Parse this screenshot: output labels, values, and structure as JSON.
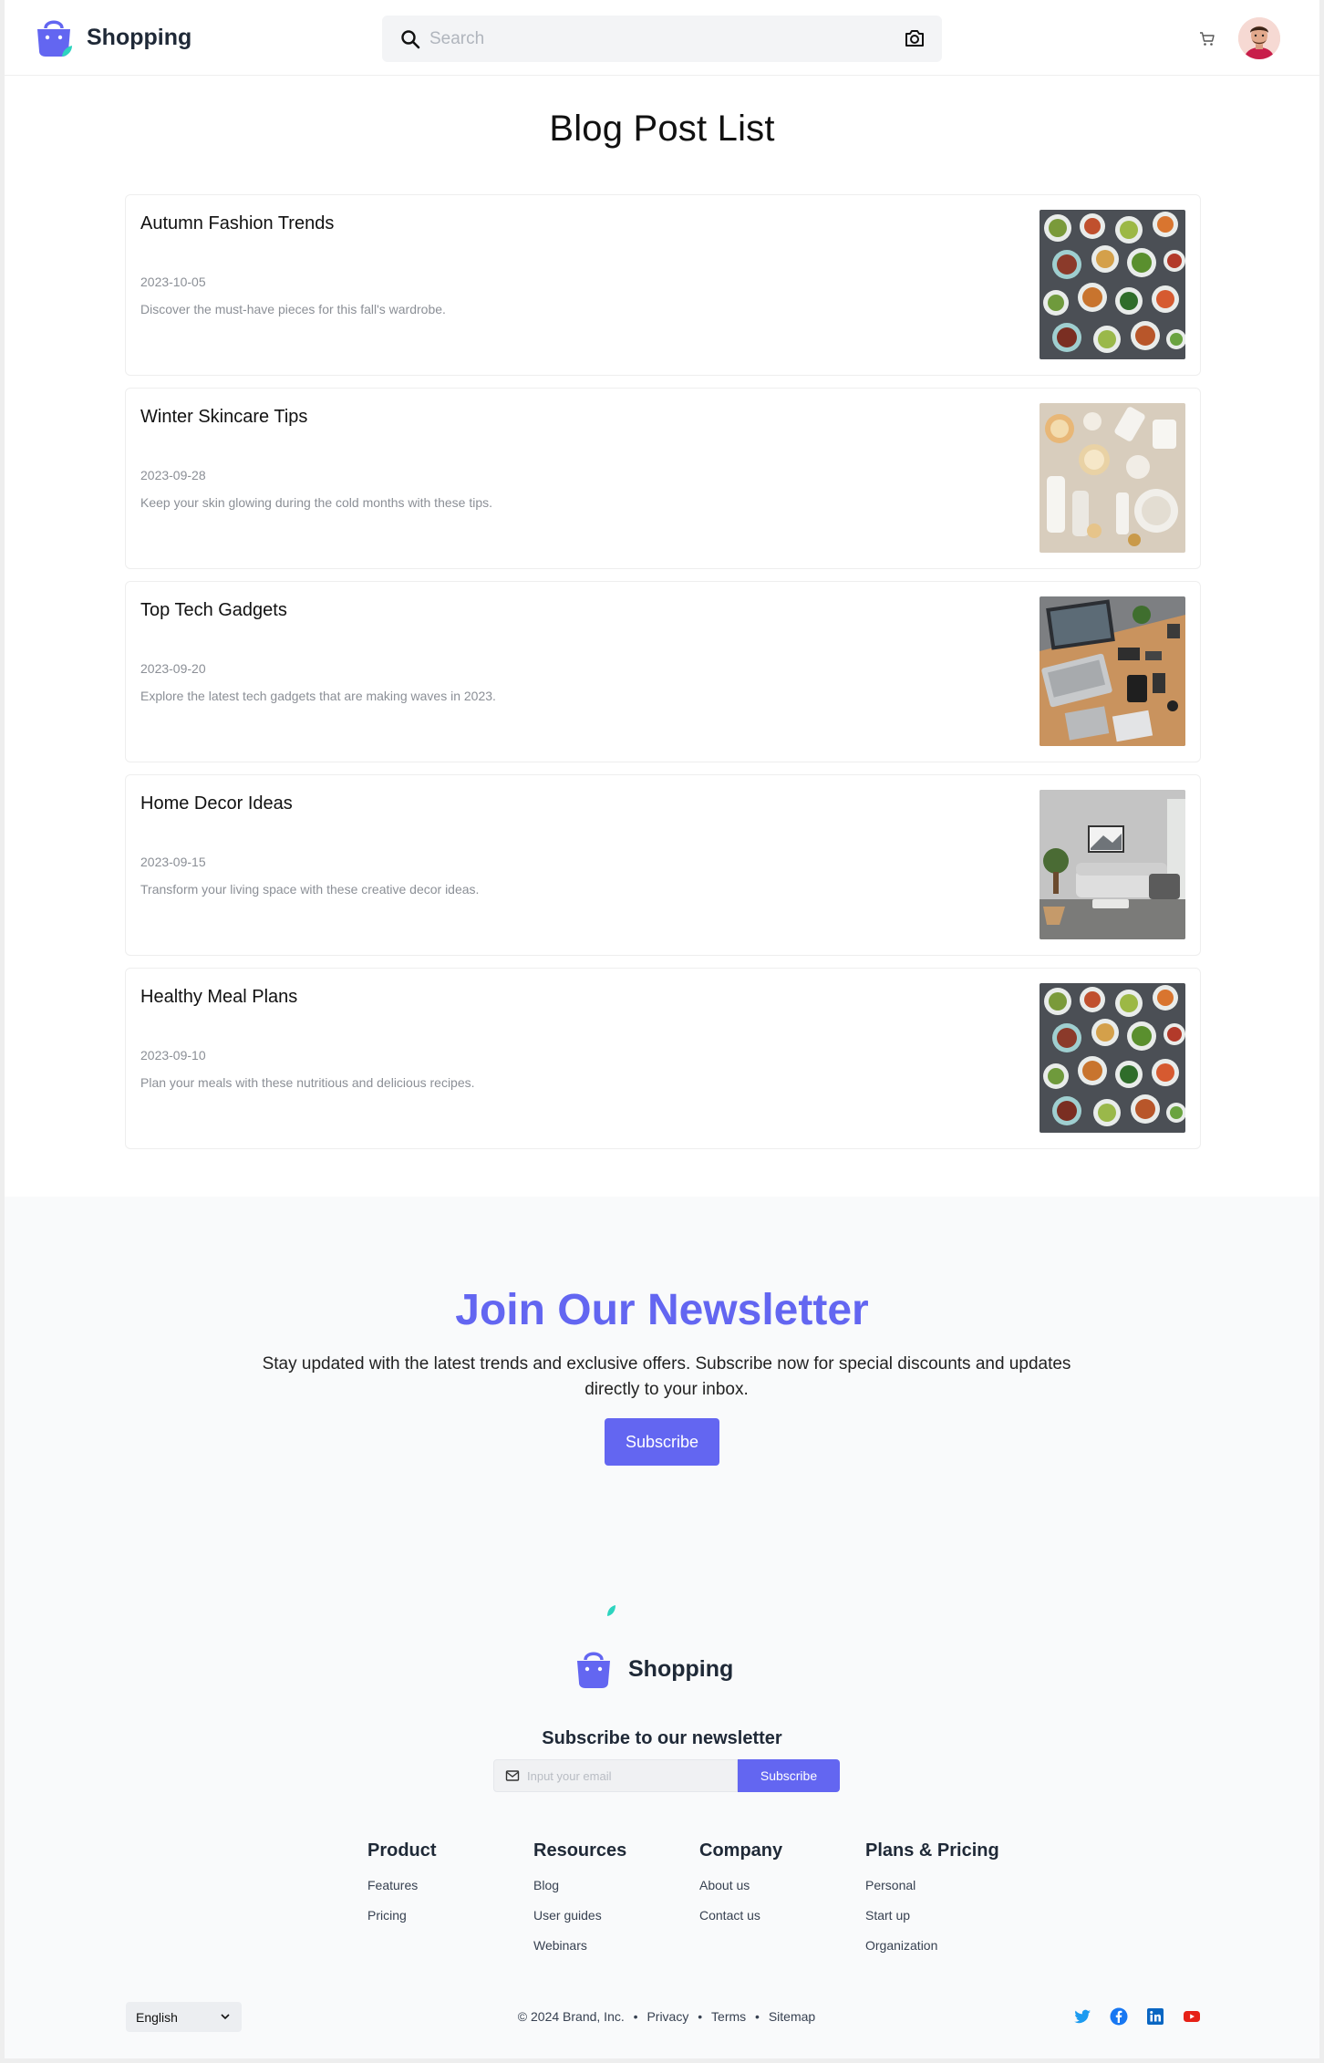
{
  "header": {
    "brand": "Shopping",
    "search_placeholder": "Search"
  },
  "page_title": "Blog Post List",
  "posts": [
    {
      "title": "Autumn Fashion Trends",
      "date": "2023-10-05",
      "description": "Discover the must-have pieces for this fall's wardrobe.",
      "image": "food-bowls"
    },
    {
      "title": "Winter Skincare Tips",
      "date": "2023-09-28",
      "description": "Keep your skin glowing during the cold months with these tips.",
      "image": "skincare-products"
    },
    {
      "title": "Top Tech Gadgets",
      "date": "2023-09-20",
      "description": "Explore the latest tech gadgets that are making waves in 2023.",
      "image": "tech-desk"
    },
    {
      "title": "Home Decor Ideas",
      "date": "2023-09-15",
      "description": "Transform your living space with these creative decor ideas.",
      "image": "living-room"
    },
    {
      "title": "Healthy Meal Plans",
      "date": "2023-09-10",
      "description": "Plan your meals with these nutritious and delicious recipes.",
      "image": "food-bowls"
    }
  ],
  "newsletter": {
    "title": "Join Our Newsletter",
    "text": "Stay updated with the latest trends and exclusive offers. Subscribe now for special discounts and updates directly to your inbox.",
    "button": "Subscribe"
  },
  "footer": {
    "brand": "Shopping",
    "subscribe_title": "Subscribe to our newsletter",
    "email_placeholder": "Input your email",
    "subscribe_button": "Subscribe",
    "columns": [
      {
        "title": "Product",
        "links": [
          "Features",
          "Pricing"
        ]
      },
      {
        "title": "Resources",
        "links": [
          "Blog",
          "User guides",
          "Webinars"
        ]
      },
      {
        "title": "Company",
        "links": [
          "About us",
          "Contact us"
        ]
      },
      {
        "title": "Plans & Pricing",
        "links": [
          "Personal",
          "Start up",
          "Organization"
        ]
      }
    ],
    "language": "English",
    "copyright": "© 2024 Brand, Inc.",
    "legal_links": [
      "Privacy",
      "Terms",
      "Sitemap"
    ],
    "social": [
      "twitter-icon",
      "facebook-icon",
      "linkedin-icon",
      "youtube-icon"
    ]
  },
  "colors": {
    "accent": "#6366f1",
    "leaf": "#2dd4bf",
    "twitter": "#1d9bf0",
    "facebook": "#1877f2",
    "linkedin": "#0a66c2",
    "youtube": "#e62117"
  }
}
